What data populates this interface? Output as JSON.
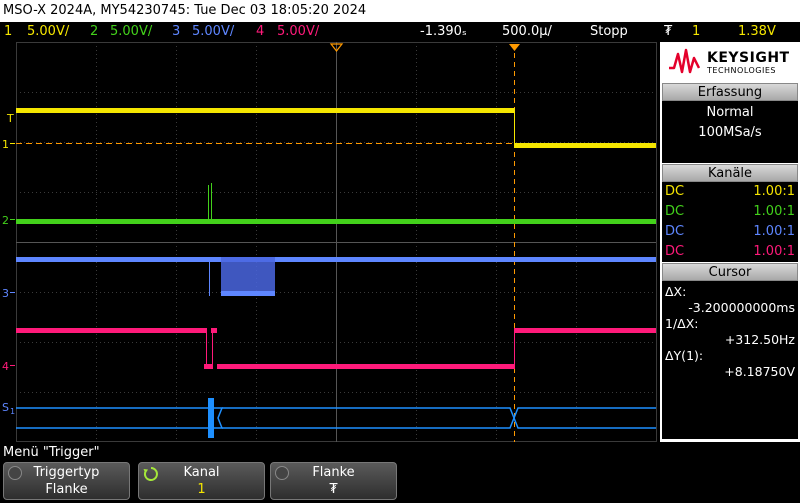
{
  "title": "MSO-X 2024A, MY54230745: Tue Dec 03 18:05:20 2024",
  "channel_bar": {
    "ch1": {
      "num": "1",
      "scale": "5.00V/"
    },
    "ch2": {
      "num": "2",
      "scale": "5.00V/"
    },
    "ch3": {
      "num": "3",
      "scale": "5.00V/"
    },
    "ch4": {
      "num": "4",
      "scale": "5.00V/"
    },
    "time_offset": "-1.390ₛ",
    "time_scale": "500.0µ/",
    "run_state": "Stopp",
    "trigger_symbol": "₮",
    "trigger_channel": "1",
    "trigger_level": "1.38V"
  },
  "markers": {
    "trigger_marker": "T",
    "ch1": "1",
    "ch2": "2",
    "ch3": "3",
    "ch4": "4",
    "serial": "S",
    "serial_sub": "1"
  },
  "panel": {
    "brand": "KEYSIGHT",
    "brand_sub": "TECHNOLOGIES",
    "acquisition": {
      "header": "Erfassung",
      "mode": "Normal",
      "rate": "100MSa/s"
    },
    "channels": {
      "header": "Kanäle",
      "rows": [
        {
          "coupling": "DC",
          "ratio": "1.00:1"
        },
        {
          "coupling": "DC",
          "ratio": "1.00:1"
        },
        {
          "coupling": "DC",
          "ratio": "1.00:1"
        },
        {
          "coupling": "DC",
          "ratio": "1.00:1"
        }
      ]
    },
    "cursor": {
      "header": "Cursor",
      "dx_label": "ΔX:",
      "dx_value": "-3.200000000ms",
      "inv_dx_label": "1/ΔX:",
      "inv_dx_value": "+312.50Hz",
      "dy_label": "ΔY(1):",
      "dy_value": "+8.18750V"
    }
  },
  "menu": {
    "label": "Menü \"Trigger\"",
    "softkeys": [
      {
        "title": "Triggertyp",
        "value": "Flanke"
      },
      {
        "title": "Kanal",
        "value": "1"
      },
      {
        "title": "Flanke",
        "value": "₮"
      }
    ]
  },
  "colors": {
    "ch1": "#f5e600",
    "ch2": "#43d11b",
    "ch3": "#5e86ff",
    "ch4": "#ff1a7a",
    "serial": "#1e90ff",
    "trigger": "#ff9a00"
  }
}
